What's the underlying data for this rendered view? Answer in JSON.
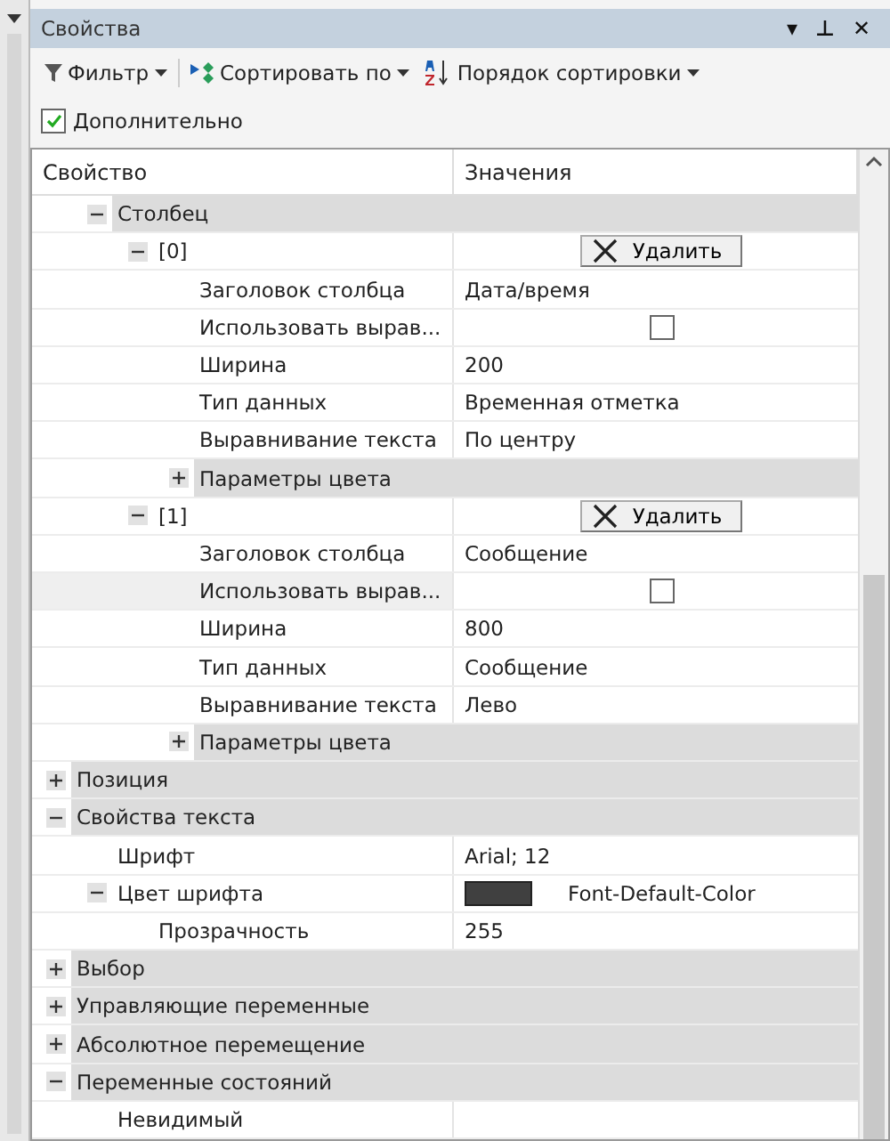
{
  "panel": {
    "title": "Свойства",
    "buttons": [
      "▾",
      "⊥",
      "✕"
    ]
  },
  "toolbar": {
    "items": [
      {
        "kind": "filter",
        "label": "Фильтр"
      },
      {
        "kind": "sortby",
        "label": "Сортировать по"
      },
      {
        "kind": "order",
        "label": "Порядок сортировки"
      }
    ]
  },
  "advanced": {
    "label": "Дополнительно",
    "checked": true
  },
  "grid": {
    "columns": [
      "Свойство",
      "Значения"
    ],
    "rows": [
      {
        "kind": "continued",
        "children": [
          {
            "kind": "group",
            "label": "Столбец",
            "expanded": true,
            "children": [
              {
                "kind": "item",
                "label": "[0]",
                "expanded": true,
                "selected": false,
                "value": {
                  "kind": "button",
                  "text": "Удалить"
                },
                "children": [
                  {
                    "kind": "item",
                    "label": "Заголовок столбца",
                    "selected": false,
                    "value": {
                      "kind": "text",
                      "text": "Дата/время"
                    }
                  },
                  {
                    "kind": "item",
                    "label": "Использовать вырав...",
                    "selected": false,
                    "value": {
                      "kind": "checkbox",
                      "checked": false
                    }
                  },
                  {
                    "kind": "item",
                    "label": "Ширина",
                    "selected": false,
                    "value": {
                      "kind": "text",
                      "text": "200"
                    }
                  },
                  {
                    "kind": "item",
                    "label": "Тип данных",
                    "selected": false,
                    "value": {
                      "kind": "text",
                      "text": "Временная отметка"
                    }
                  },
                  {
                    "kind": "item",
                    "label": "Выравнивание текста",
                    "selected": false,
                    "value": {
                      "kind": "text",
                      "text": "По центру"
                    }
                  },
                  {
                    "kind": "group",
                    "label": "Параметры цвета",
                    "expanded": false
                  }
                ]
              },
              {
                "kind": "item",
                "label": "[1]",
                "expanded": true,
                "selected": false,
                "value": {
                  "kind": "button",
                  "text": "Удалить"
                },
                "children": [
                  {
                    "kind": "item",
                    "label": "Заголовок столбца",
                    "selected": false,
                    "value": {
                      "kind": "text",
                      "text": "Сообщение"
                    }
                  },
                  {
                    "kind": "item",
                    "label": "Использовать вырав...",
                    "selected": true,
                    "value": {
                      "kind": "checkbox",
                      "checked": false
                    }
                  },
                  {
                    "kind": "item",
                    "label": "Ширина",
                    "selected": false,
                    "value": {
                      "kind": "text",
                      "text": "800"
                    }
                  },
                  {
                    "kind": "item",
                    "label": "Тип данных",
                    "selected": false,
                    "value": {
                      "kind": "text",
                      "text": "Сообщение"
                    }
                  },
                  {
                    "kind": "item",
                    "label": "Выравнивание текста",
                    "selected": false,
                    "value": {
                      "kind": "text",
                      "text": "Лево"
                    }
                  },
                  {
                    "kind": "group",
                    "label": "Параметры цвета",
                    "expanded": false
                  }
                ]
              }
            ]
          }
        ]
      },
      {
        "kind": "group",
        "label": "Позиция",
        "expanded": false
      },
      {
        "kind": "group",
        "label": "Свойства текста",
        "expanded": true,
        "children": [
          {
            "kind": "item",
            "label": "Шрифт",
            "selected": false,
            "value": {
              "kind": "text",
              "text": "Arial; 12"
            }
          },
          {
            "kind": "item",
            "label": "Цвет шрифта",
            "expanded": true,
            "selected": false,
            "value": {
              "kind": "color",
              "color": "#404040",
              "text": "Font-Default-Color"
            },
            "children": [
              {
                "kind": "item",
                "label": "Прозрачность",
                "selected": false,
                "value": {
                  "kind": "text",
                  "text": "255"
                }
              }
            ]
          }
        ]
      },
      {
        "kind": "group",
        "label": "Выбор",
        "expanded": false
      },
      {
        "kind": "group",
        "label": "Управляющие переменные",
        "expanded": false
      },
      {
        "kind": "group",
        "label": "Абсолютное перемещение",
        "expanded": false
      },
      {
        "kind": "group",
        "label": "Переменные состояний",
        "expanded": true,
        "children": [
          {
            "kind": "item",
            "label": "Невидимый",
            "selected": false
          }
        ]
      }
    ]
  }
}
